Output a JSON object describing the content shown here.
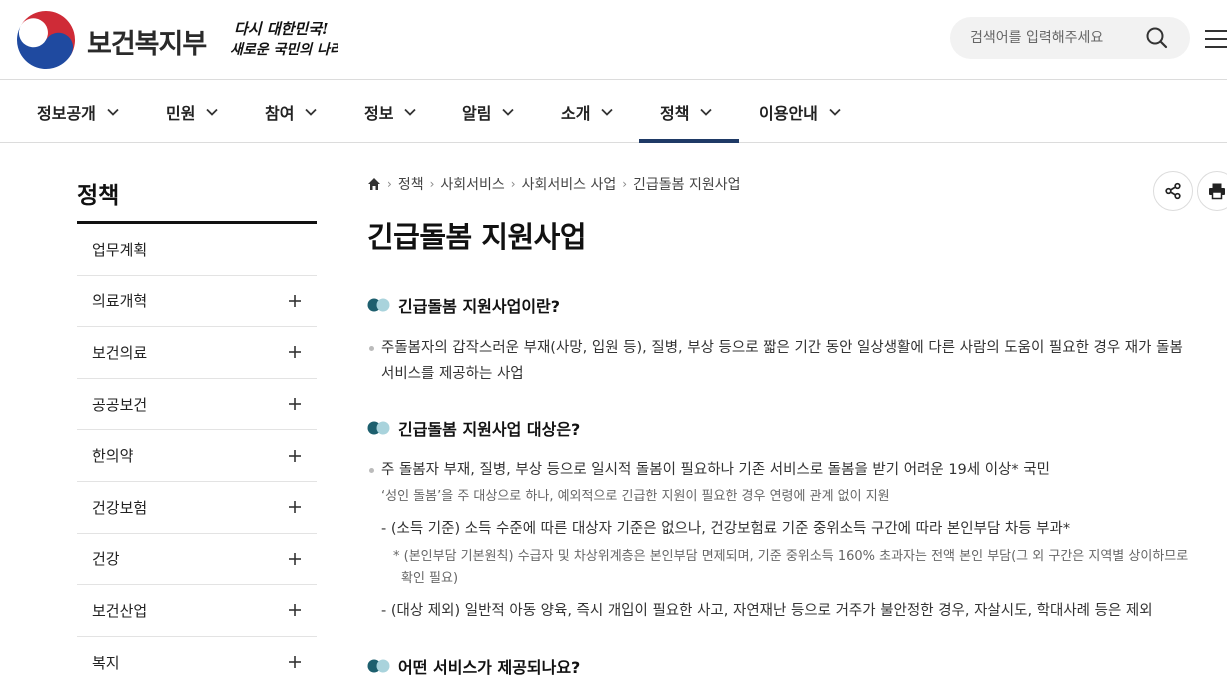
{
  "header": {
    "org_name": "보건복지부",
    "slogan_line1": "다시 대한민국!",
    "slogan_line2": "새로운 국민의 나라",
    "search_placeholder": "검색어를 입력해주세요"
  },
  "gnb": {
    "items": [
      {
        "label": "정보공개"
      },
      {
        "label": "민원"
      },
      {
        "label": "참여"
      },
      {
        "label": "정보"
      },
      {
        "label": "알림"
      },
      {
        "label": "소개"
      },
      {
        "label": "정책",
        "active": true
      },
      {
        "label": "이용안내"
      }
    ],
    "active_color": "#1f3a66"
  },
  "lnb": {
    "title": "정책",
    "items": [
      {
        "label": "업무계획",
        "expandable": false
      },
      {
        "label": "의료개혁",
        "expandable": true
      },
      {
        "label": "보건의료",
        "expandable": true
      },
      {
        "label": "공공보건",
        "expandable": true
      },
      {
        "label": "한의약",
        "expandable": true
      },
      {
        "label": "건강보험",
        "expandable": true
      },
      {
        "label": "건강",
        "expandable": true
      },
      {
        "label": "보건산업",
        "expandable": true
      },
      {
        "label": "복지",
        "expandable": true
      }
    ]
  },
  "breadcrumb": [
    "정책",
    "사회서비스",
    "사회서비스 사업",
    "긴급돌봄 지원사업"
  ],
  "page_title": "긴급돌봄 지원사업",
  "sections": {
    "s1": {
      "heading": "긴급돌봄 지원사업이란?",
      "line1": "주돌봄자의 갑작스러운 부재(사망, 입원 등), 질병, 부상 등으로 짧은 기간 동안 일상생활에 다른 사람의 도움이 필요한 경우 재가 돌봄",
      "line2": "서비스를 제공하는 사업"
    },
    "s2": {
      "heading": "긴급돌봄 지원사업 대상은?",
      "line1": "주 돌봄자 부재, 질병, 부상 등으로 일시적 돌봄이 필요하나 기존 서비스로 돌봄을 받기 어려운 19세 이상* 국민",
      "note1": "‘성인 돌봄’을 주 대상으로 하나, 예외적으로 긴급한 지원이 필요한 경우 연령에 관계 없이 지원",
      "dash1": "- (소득 기준) 소득 수준에 따른 대상자 기준은 없으나, 건강보험료 기준 중위소득 구간에 따라 본인부담 차등 부과*",
      "star1a": "* (본인부담 기본원칙) 수급자 및 차상위계층은 본인부담 면제되며, 기준 중위소득 160% 초과자는 전액 본인 부담(그 외 구간은 지역별 상이하므로",
      "star1b": "확인 필요)",
      "dash2": "- (대상 제외) 일반적 아동 양육, 즉시 개입이 필요한 사고, 자연재난 등으로 거주가 불안정한 경우, 자살시도, 학대사례 등은 제외"
    },
    "s3": {
      "heading": "어떤 서비스가 제공되나요?"
    }
  },
  "icons": {
    "share": "share-icon",
    "print": "print-icon",
    "search": "search-icon",
    "menu": "hamburger-icon",
    "home": "home-icon"
  },
  "colors": {
    "toggle_dark": "#1d5f6e",
    "toggle_light": "#a9d3dc"
  }
}
